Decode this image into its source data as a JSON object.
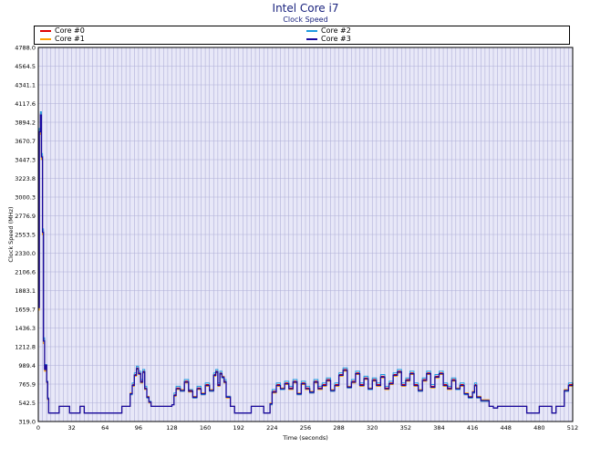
{
  "chart_data": {
    "type": "line",
    "title": "Intel Core i7",
    "subtitle": "Clock Speed",
    "xlabel": "Time (seconds)",
    "ylabel": "Clock Speed (MHz)",
    "xlim": [
      0,
      512
    ],
    "ylim": [
      319.0,
      4788.0
    ],
    "x_ticks": [
      "0",
      "32",
      "64",
      "96",
      "128",
      "160",
      "192",
      "224",
      "256",
      "288",
      "320",
      "352",
      "384",
      "416",
      "448",
      "480",
      "512"
    ],
    "y_ticks": [
      "319.0",
      "542.5",
      "765.9",
      "989.4",
      "1212.8",
      "1436.3",
      "1659.7",
      "1883.1",
      "2106.6",
      "2330.0",
      "2553.5",
      "2776.9",
      "3000.3",
      "3223.8",
      "3447.3",
      "3670.7",
      "3894.2",
      "4117.6",
      "4341.1",
      "4564.5",
      "4788.0"
    ],
    "grid": true,
    "legend_position": "top",
    "background_color": "#e8e8f8",
    "grid_color": "#b0b0d8",
    "series": [
      {
        "name": "Core #0",
        "color": "#e00000",
        "x": [
          0,
          1,
          2,
          3,
          4,
          5,
          6,
          7,
          8,
          9,
          10,
          12,
          14,
          20,
          30,
          34,
          40,
          44,
          48,
          60,
          64,
          70,
          76,
          80,
          84,
          88,
          90,
          92,
          94,
          96,
          98,
          100,
          102,
          104,
          106,
          108,
          110,
          114,
          120,
          126,
          128,
          130,
          132,
          136,
          140,
          144,
          148,
          152,
          156,
          160,
          164,
          168,
          170,
          172,
          174,
          176,
          178,
          180,
          184,
          188,
          190,
          192,
          194,
          198,
          204,
          210,
          214,
          216,
          220,
          222,
          224,
          228,
          232,
          236,
          240,
          244,
          248,
          252,
          256,
          260,
          264,
          268,
          272,
          276,
          280,
          284,
          288,
          292,
          296,
          300,
          304,
          308,
          312,
          316,
          320,
          324,
          328,
          332,
          336,
          340,
          344,
          348,
          352,
          356,
          360,
          364,
          368,
          372,
          376,
          380,
          384,
          388,
          392,
          396,
          400,
          404,
          408,
          412,
          416,
          418,
          420,
          424,
          432,
          436,
          440,
          444,
          448,
          452,
          456,
          460,
          464,
          468,
          472,
          476,
          480,
          484,
          488,
          492,
          496,
          500,
          504,
          508,
          512
        ],
        "y": [
          1700,
          3800,
          4000,
          3500,
          2600,
          1300,
          950,
          1000,
          800,
          600,
          420,
          420,
          420,
          500,
          420,
          420,
          500,
          420,
          420,
          420,
          420,
          420,
          420,
          500,
          500,
          640,
          760,
          880,
          960,
          900,
          800,
          920,
          720,
          600,
          560,
          500,
          500,
          500,
          500,
          500,
          520,
          640,
          720,
          680,
          800,
          690,
          600,
          720,
          640,
          760,
          680,
          880,
          920,
          760,
          900,
          840,
          800,
          620,
          500,
          420,
          420,
          420,
          420,
          420,
          500,
          500,
          500,
          420,
          420,
          520,
          680,
          760,
          700,
          780,
          720,
          800,
          640,
          780,
          720,
          660,
          800,
          720,
          760,
          820,
          680,
          760,
          880,
          940,
          720,
          800,
          900,
          760,
          840,
          700,
          820,
          760,
          860,
          720,
          780,
          880,
          920,
          760,
          820,
          900,
          760,
          680,
          820,
          900,
          740,
          860,
          900,
          760,
          720,
          820,
          700,
          760,
          640,
          600,
          660,
          760,
          600,
          560,
          500,
          480,
          500,
          500,
          500,
          500,
          500,
          500,
          500,
          420,
          420,
          420,
          500,
          500,
          500,
          420,
          500,
          500,
          680,
          760,
          820
        ]
      },
      {
        "name": "Core #1",
        "color": "#ffa000",
        "x": [
          0,
          1,
          2,
          3,
          4,
          5,
          6,
          7,
          8,
          9,
          10,
          12,
          14,
          20,
          30,
          34,
          40,
          44,
          48,
          60,
          64,
          70,
          76,
          80,
          84,
          88,
          90,
          92,
          94,
          96,
          98,
          100,
          102,
          104,
          106,
          108,
          110,
          114,
          120,
          126,
          128,
          130,
          132,
          136,
          140,
          144,
          148,
          152,
          156,
          160,
          164,
          168,
          170,
          172,
          174,
          176,
          178,
          180,
          184,
          188,
          190,
          192,
          194,
          198,
          204,
          210,
          214,
          216,
          220,
          222,
          224,
          228,
          232,
          236,
          240,
          244,
          248,
          252,
          256,
          260,
          264,
          268,
          272,
          276,
          280,
          284,
          288,
          292,
          296,
          300,
          304,
          308,
          312,
          316,
          320,
          324,
          328,
          332,
          336,
          340,
          344,
          348,
          352,
          356,
          360,
          364,
          368,
          372,
          376,
          380,
          384,
          388,
          392,
          396,
          400,
          404,
          408,
          412,
          416,
          418,
          420,
          424,
          432,
          436,
          440,
          444,
          448,
          452,
          456,
          460,
          464,
          468,
          472,
          476,
          480,
          484,
          488,
          492,
          496,
          500,
          504,
          508,
          512
        ],
        "y": [
          1650,
          3750,
          3950,
          3450,
          2550,
          1250,
          920,
          980,
          780,
          580,
          420,
          420,
          420,
          500,
          420,
          420,
          500,
          420,
          420,
          420,
          420,
          420,
          420,
          500,
          500,
          660,
          740,
          860,
          940,
          880,
          780,
          900,
          700,
          620,
          540,
          500,
          500,
          500,
          500,
          500,
          520,
          620,
          700,
          700,
          780,
          670,
          620,
          700,
          660,
          740,
          700,
          860,
          900,
          740,
          880,
          860,
          780,
          600,
          500,
          420,
          420,
          420,
          420,
          420,
          500,
          500,
          500,
          420,
          420,
          540,
          660,
          740,
          720,
          760,
          700,
          780,
          660,
          760,
          700,
          680,
          780,
          700,
          740,
          800,
          700,
          740,
          860,
          920,
          740,
          780,
          880,
          740,
          820,
          720,
          800,
          740,
          840,
          700,
          760,
          860,
          900,
          740,
          800,
          880,
          740,
          700,
          800,
          880,
          720,
          840,
          880,
          740,
          700,
          800,
          720,
          740,
          660,
          620,
          680,
          740,
          620,
          580,
          500,
          480,
          500,
          500,
          500,
          500,
          500,
          500,
          500,
          420,
          420,
          420,
          500,
          500,
          500,
          420,
          500,
          500,
          700,
          740,
          860
        ]
      },
      {
        "name": "Core #2",
        "color": "#1e9be0",
        "x": [
          0,
          1,
          2,
          3,
          4,
          5,
          6,
          7,
          8,
          9,
          10,
          12,
          14,
          20,
          30,
          34,
          40,
          44,
          48,
          60,
          64,
          70,
          76,
          80,
          84,
          88,
          90,
          92,
          94,
          96,
          98,
          100,
          102,
          104,
          106,
          108,
          110,
          114,
          120,
          126,
          128,
          130,
          132,
          136,
          140,
          144,
          148,
          152,
          156,
          160,
          164,
          168,
          170,
          172,
          174,
          176,
          178,
          180,
          184,
          188,
          190,
          192,
          194,
          198,
          204,
          210,
          214,
          216,
          220,
          222,
          224,
          228,
          232,
          236,
          240,
          244,
          248,
          252,
          256,
          260,
          264,
          268,
          272,
          276,
          280,
          284,
          288,
          292,
          296,
          300,
          304,
          308,
          312,
          316,
          320,
          324,
          328,
          332,
          336,
          340,
          344,
          348,
          352,
          356,
          360,
          364,
          368,
          372,
          376,
          380,
          384,
          388,
          392,
          396,
          400,
          404,
          408,
          412,
          416,
          418,
          420,
          424,
          432,
          436,
          440,
          444,
          448,
          452,
          456,
          460,
          464,
          468,
          472,
          476,
          480,
          484,
          488,
          492,
          496,
          500,
          504,
          508,
          512
        ],
        "y": [
          1720,
          3820,
          4020,
          3520,
          2620,
          1320,
          960,
          1000,
          800,
          600,
          420,
          420,
          420,
          500,
          420,
          420,
          500,
          420,
          420,
          420,
          420,
          420,
          420,
          500,
          500,
          640,
          780,
          900,
          980,
          920,
          820,
          940,
          740,
          600,
          560,
          500,
          500,
          500,
          500,
          500,
          520,
          660,
          740,
          680,
          820,
          700,
          600,
          740,
          640,
          780,
          680,
          900,
          940,
          780,
          920,
          840,
          820,
          620,
          500,
          420,
          420,
          420,
          420,
          420,
          500,
          500,
          500,
          420,
          420,
          520,
          700,
          780,
          700,
          800,
          740,
          820,
          640,
          800,
          740,
          660,
          820,
          740,
          780,
          840,
          680,
          780,
          900,
          960,
          720,
          820,
          920,
          780,
          860,
          700,
          840,
          780,
          880,
          740,
          800,
          900,
          940,
          780,
          840,
          920,
          780,
          680,
          840,
          920,
          760,
          880,
          920,
          780,
          740,
          840,
          700,
          780,
          640,
          600,
          660,
          780,
          600,
          560,
          500,
          480,
          500,
          500,
          500,
          500,
          500,
          500,
          500,
          420,
          420,
          420,
          500,
          500,
          500,
          420,
          500,
          500,
          680,
          780,
          800
        ]
      },
      {
        "name": "Core #3",
        "color": "#1a0aa0",
        "x": [
          0,
          1,
          2,
          3,
          4,
          5,
          6,
          7,
          8,
          9,
          10,
          12,
          14,
          20,
          30,
          34,
          40,
          44,
          48,
          60,
          64,
          70,
          76,
          80,
          84,
          88,
          90,
          92,
          94,
          96,
          98,
          100,
          102,
          104,
          106,
          108,
          110,
          114,
          120,
          126,
          128,
          130,
          132,
          136,
          140,
          144,
          148,
          152,
          156,
          160,
          164,
          168,
          170,
          172,
          174,
          176,
          178,
          180,
          184,
          188,
          190,
          192,
          194,
          198,
          204,
          210,
          214,
          216,
          220,
          222,
          224,
          228,
          232,
          236,
          240,
          244,
          248,
          252,
          256,
          260,
          264,
          268,
          272,
          276,
          280,
          284,
          288,
          292,
          296,
          300,
          304,
          308,
          312,
          316,
          320,
          324,
          328,
          332,
          336,
          340,
          344,
          348,
          352,
          356,
          360,
          364,
          368,
          372,
          376,
          380,
          384,
          388,
          392,
          396,
          400,
          404,
          408,
          412,
          416,
          418,
          420,
          424,
          432,
          436,
          440,
          444,
          448,
          452,
          456,
          460,
          464,
          468,
          472,
          476,
          480,
          484,
          488,
          492,
          496,
          500,
          504,
          508,
          512
        ],
        "y": [
          1680,
          3780,
          3980,
          3480,
          2580,
          1280,
          940,
          990,
          790,
          590,
          420,
          420,
          420,
          500,
          420,
          420,
          500,
          420,
          420,
          420,
          420,
          420,
          420,
          500,
          500,
          650,
          750,
          870,
          950,
          890,
          790,
          910,
          710,
          610,
          550,
          500,
          500,
          500,
          500,
          500,
          520,
          630,
          710,
          690,
          790,
          680,
          610,
          710,
          650,
          750,
          690,
          870,
          910,
          750,
          890,
          850,
          790,
          610,
          500,
          420,
          420,
          420,
          420,
          420,
          500,
          500,
          500,
          420,
          420,
          530,
          670,
          750,
          710,
          770,
          710,
          790,
          650,
          770,
          710,
          670,
          790,
          710,
          750,
          810,
          690,
          750,
          870,
          930,
          730,
          790,
          890,
          750,
          830,
          710,
          810,
          750,
          850,
          710,
          770,
          870,
          910,
          750,
          810,
          890,
          750,
          690,
          810,
          890,
          730,
          850,
          890,
          750,
          710,
          810,
          710,
          750,
          650,
          610,
          670,
          750,
          610,
          570,
          500,
          480,
          500,
          500,
          500,
          500,
          500,
          500,
          500,
          420,
          420,
          420,
          500,
          500,
          500,
          420,
          500,
          500,
          690,
          750,
          780
        ]
      }
    ]
  }
}
